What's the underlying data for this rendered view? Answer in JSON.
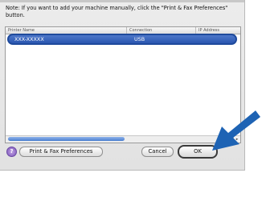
{
  "note": "Note: If you want to add your machine manually, click the \"Print & Fax Preferences\" button.",
  "table": {
    "columns": [
      "Printer Name",
      "Connection",
      "IP Address"
    ],
    "rows": [
      {
        "name": "XXX-XXXXX",
        "connection": "USB"
      }
    ]
  },
  "scrollbar": {
    "left_arrow": "◂",
    "right_arrow": "▸"
  },
  "buttons": {
    "help": "?",
    "prefs": "Print & Fax Preferences",
    "cancel": "Cancel",
    "ok": "OK"
  },
  "colors": {
    "selection": "#2a56b0",
    "arrow": "#1e63b4"
  },
  "icons": [
    "help-icon",
    "pointer-arrow-icon"
  ]
}
